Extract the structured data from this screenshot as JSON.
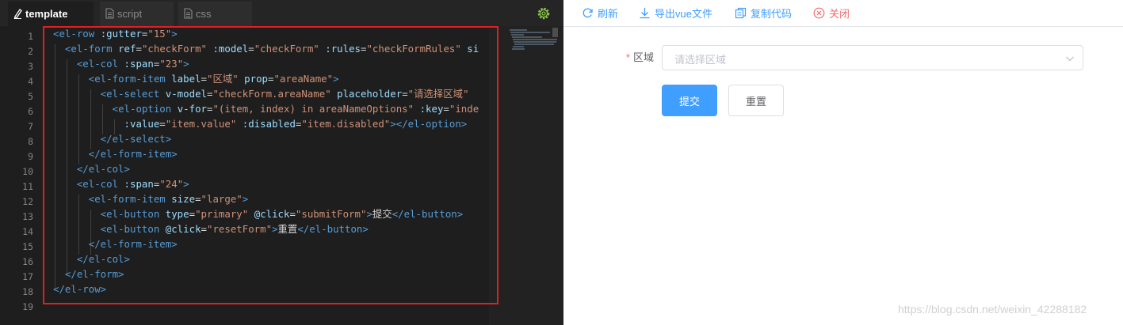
{
  "editor": {
    "tabs": [
      {
        "label": "template",
        "active": true
      },
      {
        "label": "script",
        "active": false
      },
      {
        "label": "css",
        "active": false
      }
    ],
    "line_numbers": [
      "1",
      "2",
      "3",
      "4",
      "5",
      "6",
      "7",
      "8",
      "9",
      "10",
      "11",
      "12",
      "13",
      "14",
      "15",
      "16",
      "17",
      "18",
      "19"
    ]
  },
  "preview": {
    "toolbar": {
      "refresh": "刷新",
      "export": "导出vue文件",
      "copy": "复制代码",
      "close": "关闭"
    },
    "form": {
      "label": "区域",
      "required_mark": "*",
      "placeholder": "请选择区域",
      "submit": "提交",
      "reset": "重置"
    },
    "watermark": "https://blog.csdn.net/weixin_42288182"
  },
  "colors": {
    "accent": "#409eff",
    "danger": "#f56c6c",
    "highlight_box": "#e02020"
  }
}
